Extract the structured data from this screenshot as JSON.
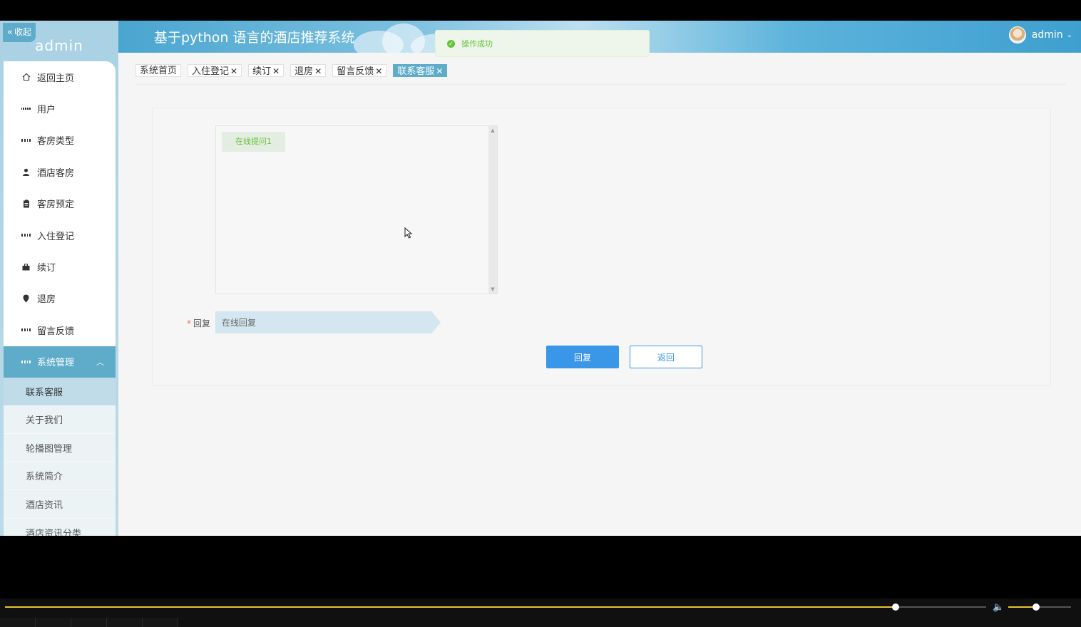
{
  "sidebar": {
    "collapse_label": "收起",
    "brand": "admin",
    "menu": [
      {
        "label": "返回主页",
        "icon": "home-icon"
      },
      {
        "label": "用户",
        "icon": "grid-icon"
      },
      {
        "label": "客房类型",
        "icon": "grid-icon"
      },
      {
        "label": "酒店客房",
        "icon": "user-icon"
      },
      {
        "label": "客房预定",
        "icon": "clipboard-icon"
      },
      {
        "label": "入住登记",
        "icon": "grid-icon"
      },
      {
        "label": "续订",
        "icon": "briefcase-icon"
      },
      {
        "label": "退房",
        "icon": "location-pin-icon"
      },
      {
        "label": "留言反馈",
        "icon": "grid-icon"
      }
    ],
    "system_menu": {
      "label": "系统管理",
      "icon": "grid-icon",
      "expanded": true
    },
    "submenu": [
      {
        "label": "联系客服",
        "selected": true
      },
      {
        "label": "关于我们"
      },
      {
        "label": "轮播图管理"
      },
      {
        "label": "系统简介"
      },
      {
        "label": "酒店资讯"
      },
      {
        "label": "酒店资讯分类"
      }
    ]
  },
  "header": {
    "title": "基于python 语言的酒店推荐系统",
    "user": "admin"
  },
  "toast": {
    "text": "操作成功",
    "type": "success"
  },
  "tabs": [
    {
      "label": "系统首页",
      "closable": false
    },
    {
      "label": "入住登记",
      "closable": true
    },
    {
      "label": "续订",
      "closable": true
    },
    {
      "label": "退房",
      "closable": true
    },
    {
      "label": "留言反馈",
      "closable": true
    },
    {
      "label": "联系客服",
      "closable": true,
      "active": true
    }
  ],
  "chat": {
    "messages": [
      "在线提问1"
    ]
  },
  "form": {
    "reply_label": "回复",
    "reply_required": true,
    "reply_placeholder": "在线回复",
    "submit_label": "回复",
    "back_label": "返回"
  },
  "player": {
    "progress_percent": 90.8,
    "volume_percent": 44
  },
  "colors": {
    "accent": "#5eacc9",
    "primary_button": "#3a97e8",
    "success": "#67c23a",
    "progress": "#e8c430"
  }
}
